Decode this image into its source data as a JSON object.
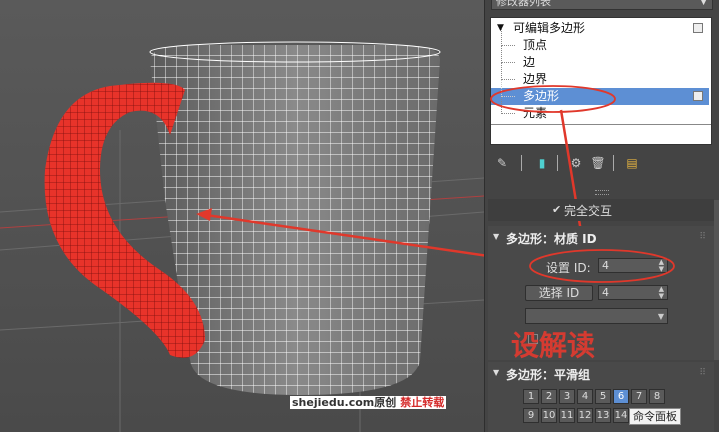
{
  "panel": {
    "modifier_list_label": "修改器列表",
    "stack_items": [
      {
        "label": "可编辑多边形",
        "level": 0
      },
      {
        "label": "顶点",
        "level": 1
      },
      {
        "label": "边",
        "level": 1
      },
      {
        "label": "边界",
        "level": 1
      },
      {
        "label": "多边形",
        "level": 1,
        "selected": true
      },
      {
        "label": "元素",
        "level": 1
      }
    ],
    "full_interact_label": "完全交互",
    "material_rollout_title": "多边形：材质 ID",
    "set_id_label": "设置 ID:",
    "set_id_value": "4",
    "select_id_label": "选择 ID",
    "select_id_value": "4",
    "smoothing_rollout_title": "多边形：平滑组",
    "smoothing_numbers": [
      "1",
      "2",
      "3",
      "4",
      "5",
      "6",
      "7",
      "8",
      "9",
      "10",
      "11",
      "12",
      "13",
      "14"
    ],
    "active_smoothing": "6"
  },
  "overlays": {
    "watermark_site": "shejiedu.com原创",
    "watermark_forbid": "禁止转载",
    "watermark_logo": "设解读",
    "command_panel_tag": "命令面板"
  },
  "colors": {
    "accent_blue": "#5d8fd4",
    "annotation_red": "#e0382b",
    "handle_red": "#e8332a"
  }
}
